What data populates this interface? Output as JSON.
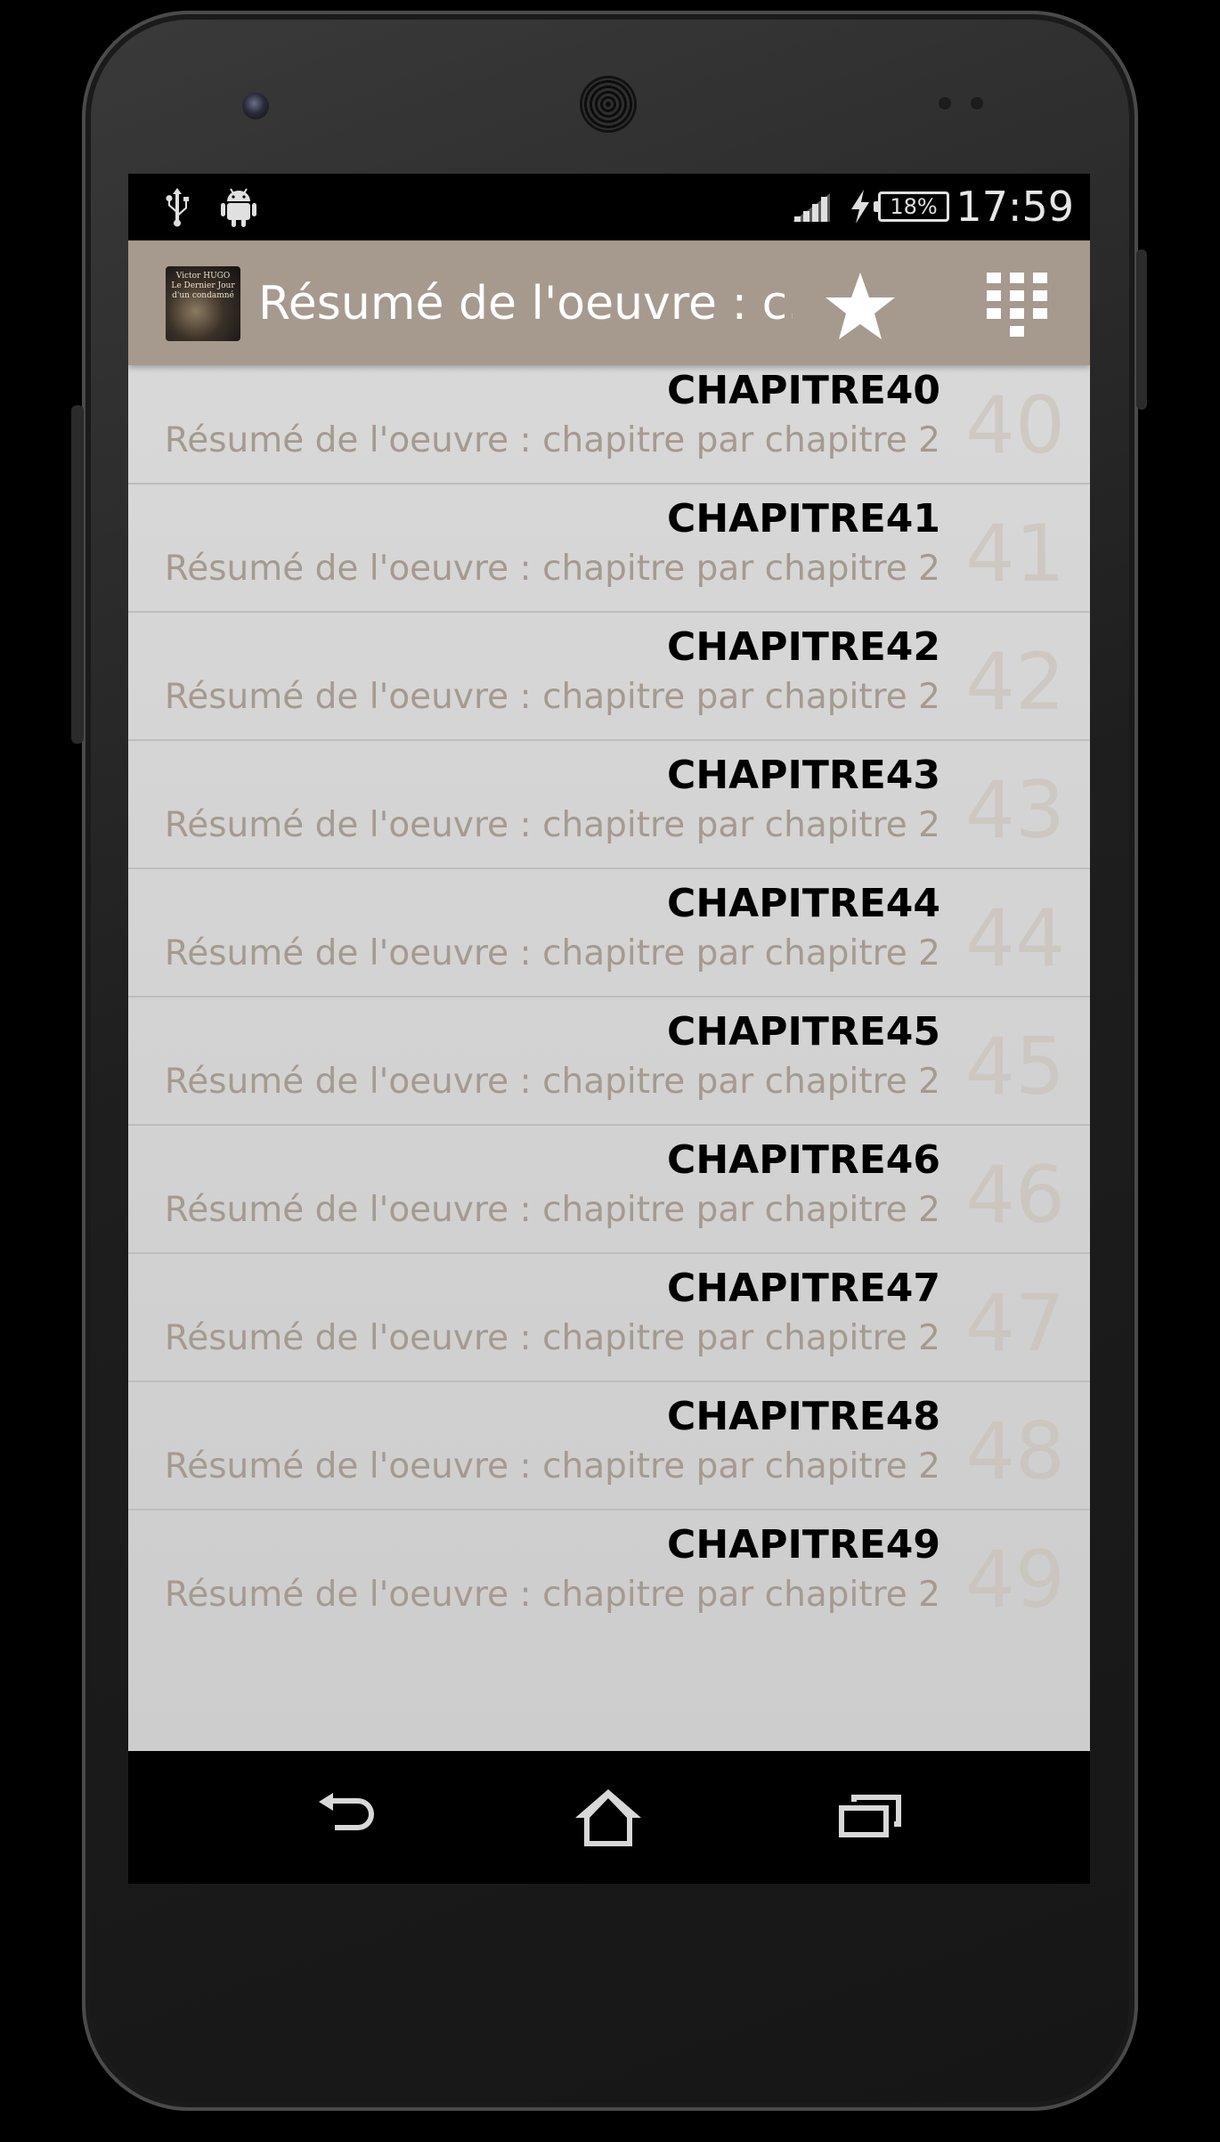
{
  "status_bar": {
    "left_icons": [
      "usb-icon",
      "android-icon"
    ],
    "right_icons": [
      "signal-icon",
      "charging-icon",
      "battery-icon"
    ],
    "battery": "18%",
    "time": "17:59"
  },
  "action_bar": {
    "title": "Résumé de l'oeuvre : c...",
    "app_icon_text": "Victor HUGO Le Dernier Jour d'un condamné",
    "actions": [
      "star-icon",
      "grid-icon"
    ]
  },
  "list": {
    "items": [
      {
        "title": "CHAPITRE40",
        "subtitle": "Résumé de l'oeuvre : chapitre par chapitre 2",
        "number": "40"
      },
      {
        "title": "CHAPITRE41",
        "subtitle": "Résumé de l'oeuvre : chapitre par chapitre 2",
        "number": "41"
      },
      {
        "title": "CHAPITRE42",
        "subtitle": "Résumé de l'oeuvre : chapitre par chapitre 2",
        "number": "42"
      },
      {
        "title": "CHAPITRE43",
        "subtitle": "Résumé de l'oeuvre : chapitre par chapitre 2",
        "number": "43"
      },
      {
        "title": "CHAPITRE44",
        "subtitle": "Résumé de l'oeuvre : chapitre par chapitre 2",
        "number": "44"
      },
      {
        "title": "CHAPITRE45",
        "subtitle": "Résumé de l'oeuvre : chapitre par chapitre 2",
        "number": "45"
      },
      {
        "title": "CHAPITRE46",
        "subtitle": "Résumé de l'oeuvre : chapitre par chapitre 2",
        "number": "46"
      },
      {
        "title": "CHAPITRE47",
        "subtitle": "Résumé de l'oeuvre : chapitre par chapitre 2",
        "number": "47"
      },
      {
        "title": "CHAPITRE48",
        "subtitle": "Résumé de l'oeuvre : chapitre par chapitre 2",
        "number": "48"
      },
      {
        "title": "CHAPITRE49",
        "subtitle": "Résumé de l'oeuvre : chapitre par chapitre 2",
        "number": "49"
      }
    ]
  },
  "nav_bar": {
    "buttons": [
      "back-icon",
      "home-icon",
      "recent-apps-icon"
    ]
  },
  "colors": {
    "action_bar": "#a69a8e",
    "subtitle": "#a69a8e",
    "list_background": "#d3d3d3"
  }
}
